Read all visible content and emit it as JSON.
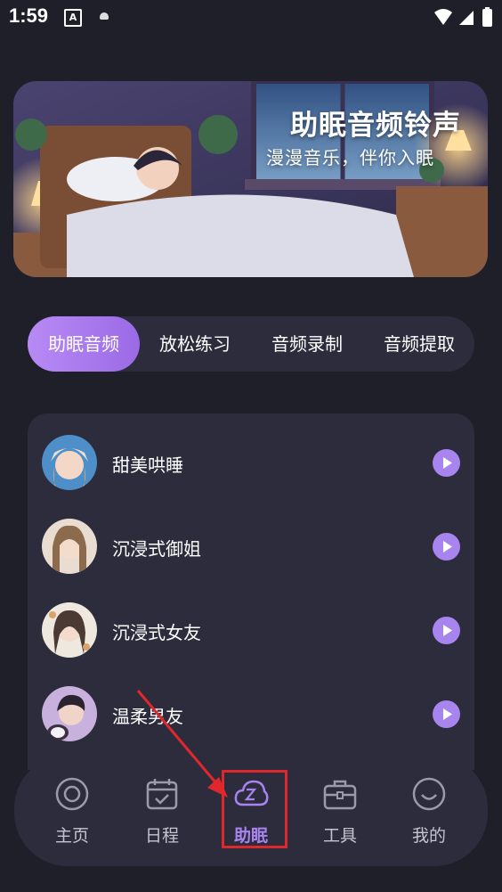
{
  "status_bar": {
    "time": "1:59",
    "notif_icon_a": "A"
  },
  "banner": {
    "title": "助眠音频铃声",
    "subtitle": "漫漫音乐，伴你入眠"
  },
  "tabs": [
    {
      "label": "助眠音频",
      "active": true
    },
    {
      "label": "放松练习",
      "active": false
    },
    {
      "label": "音频录制",
      "active": false
    },
    {
      "label": "音频提取",
      "active": false
    }
  ],
  "list": [
    {
      "title": "甜美哄睡"
    },
    {
      "title": "沉浸式御姐"
    },
    {
      "title": "沉浸式女友"
    },
    {
      "title": "温柔男友"
    }
  ],
  "bottom_nav": [
    {
      "label": "主页",
      "icon": "home-circle-icon",
      "active": false
    },
    {
      "label": "日程",
      "icon": "calendar-icon",
      "active": false
    },
    {
      "label": "助眠",
      "icon": "sleep-cloud-icon",
      "active": true
    },
    {
      "label": "工具",
      "icon": "toolbox-icon",
      "active": false
    },
    {
      "label": "我的",
      "icon": "smile-profile-icon",
      "active": false
    }
  ],
  "colors": {
    "accent": "#a884ef",
    "background": "#1f1f29",
    "panel": "#2c2c3d",
    "highlight": "#e0282c"
  }
}
